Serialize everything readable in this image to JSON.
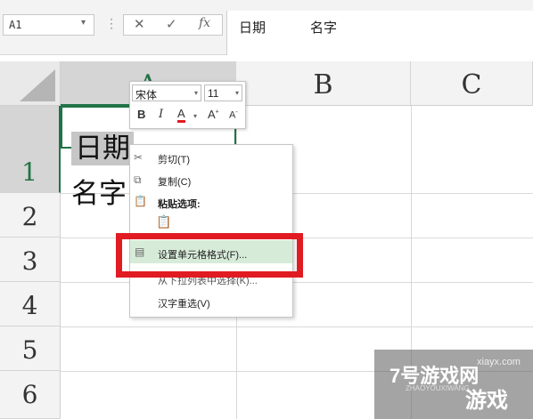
{
  "formula_bar": {
    "name_box": "A1",
    "cancel_glyph": "✕",
    "confirm_glyph": "✓",
    "fx_glyph": "fx",
    "content_col1": "日期",
    "content_col2": "名字"
  },
  "columns": [
    "A",
    "B",
    "C"
  ],
  "rows": [
    "1",
    "2",
    "3",
    "4",
    "5",
    "6"
  ],
  "cells": {
    "A1": "日期",
    "A2": "名字"
  },
  "mini_toolbar": {
    "font_name": "宋体",
    "font_size": "11",
    "bold": "B",
    "italic": "I",
    "font_color": "A",
    "grow_font": "A",
    "shrink_font": "A",
    "font_color_bar": "#e11b22"
  },
  "context_menu": {
    "cut": "剪切(T)",
    "copy": "复制(C)",
    "paste_options": "粘贴选项:",
    "format_cells": "设置单元格格式(F)...",
    "pick_from_list": "从下拉列表中选择(K)...",
    "hanzi_reselect": "汉字重选(V)"
  },
  "watermark": {
    "site": "xiayx.com",
    "brand": "7号游戏网",
    "pinyin": "ZHAOYOUXIWANG",
    "label": "游戏"
  },
  "colors": {
    "excel_green": "#217346",
    "highlight_red": "#e11b22",
    "menu_hover": "#d7ebd9"
  }
}
